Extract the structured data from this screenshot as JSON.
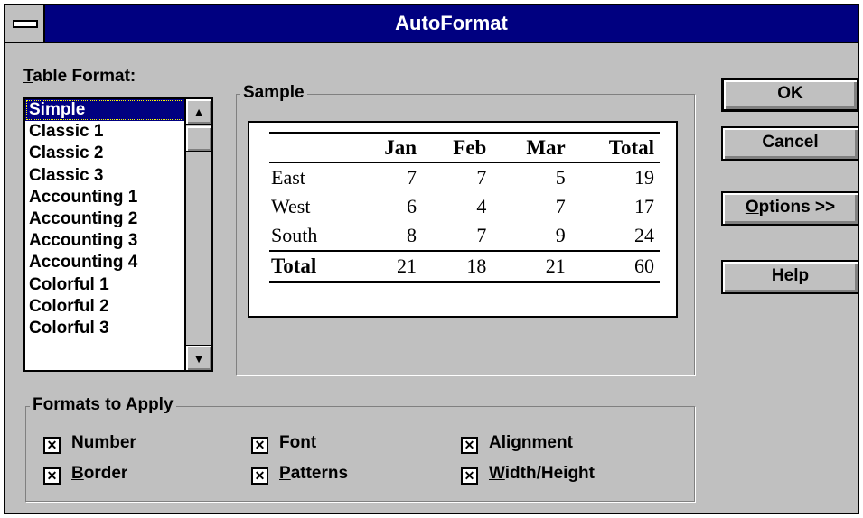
{
  "window": {
    "title": "AutoFormat"
  },
  "table_format": {
    "label_first": "T",
    "label_rest": "able Format:",
    "selected": "Simple",
    "items": [
      "Simple",
      "Classic 1",
      "Classic 2",
      "Classic 3",
      "Accounting 1",
      "Accounting 2",
      "Accounting 3",
      "Accounting 4",
      "Colorful 1",
      "Colorful 2",
      "Colorful 3"
    ]
  },
  "sample": {
    "title": "Sample",
    "headers": [
      "",
      "Jan",
      "Feb",
      "Mar",
      "Total"
    ],
    "rows": [
      [
        "East",
        "7",
        "7",
        "5",
        "19"
      ],
      [
        "West",
        "6",
        "4",
        "7",
        "17"
      ],
      [
        "South",
        "8",
        "7",
        "9",
        "24"
      ]
    ],
    "total_row": [
      "Total",
      "21",
      "18",
      "21",
      "60"
    ]
  },
  "buttons": {
    "ok": "OK",
    "cancel": "Cancel",
    "options_first": "O",
    "options_rest": "ptions >>",
    "help_first": "H",
    "help_rest": "elp"
  },
  "formats": {
    "title": "Formats to Apply",
    "number": {
      "first": "N",
      "rest": "umber",
      "checked": true
    },
    "border": {
      "first": "B",
      "rest": "order",
      "checked": true
    },
    "font": {
      "first": "F",
      "rest": "ont",
      "checked": true
    },
    "patterns": {
      "first": "P",
      "rest": "atterns",
      "checked": true
    },
    "alignment": {
      "first": "A",
      "rest": "lignment",
      "checked": true
    },
    "width_height": {
      "first": "W",
      "rest": "idth/Height",
      "checked": true
    },
    "check_mark": "✕"
  },
  "icons": {
    "scroll_up": "up-arrow-icon",
    "scroll_down": "down-arrow-icon",
    "system_menu": "system-menu-icon"
  },
  "colors": {
    "titlebar": "#000080",
    "face": "#c0c0c0",
    "selection": "#000080"
  }
}
